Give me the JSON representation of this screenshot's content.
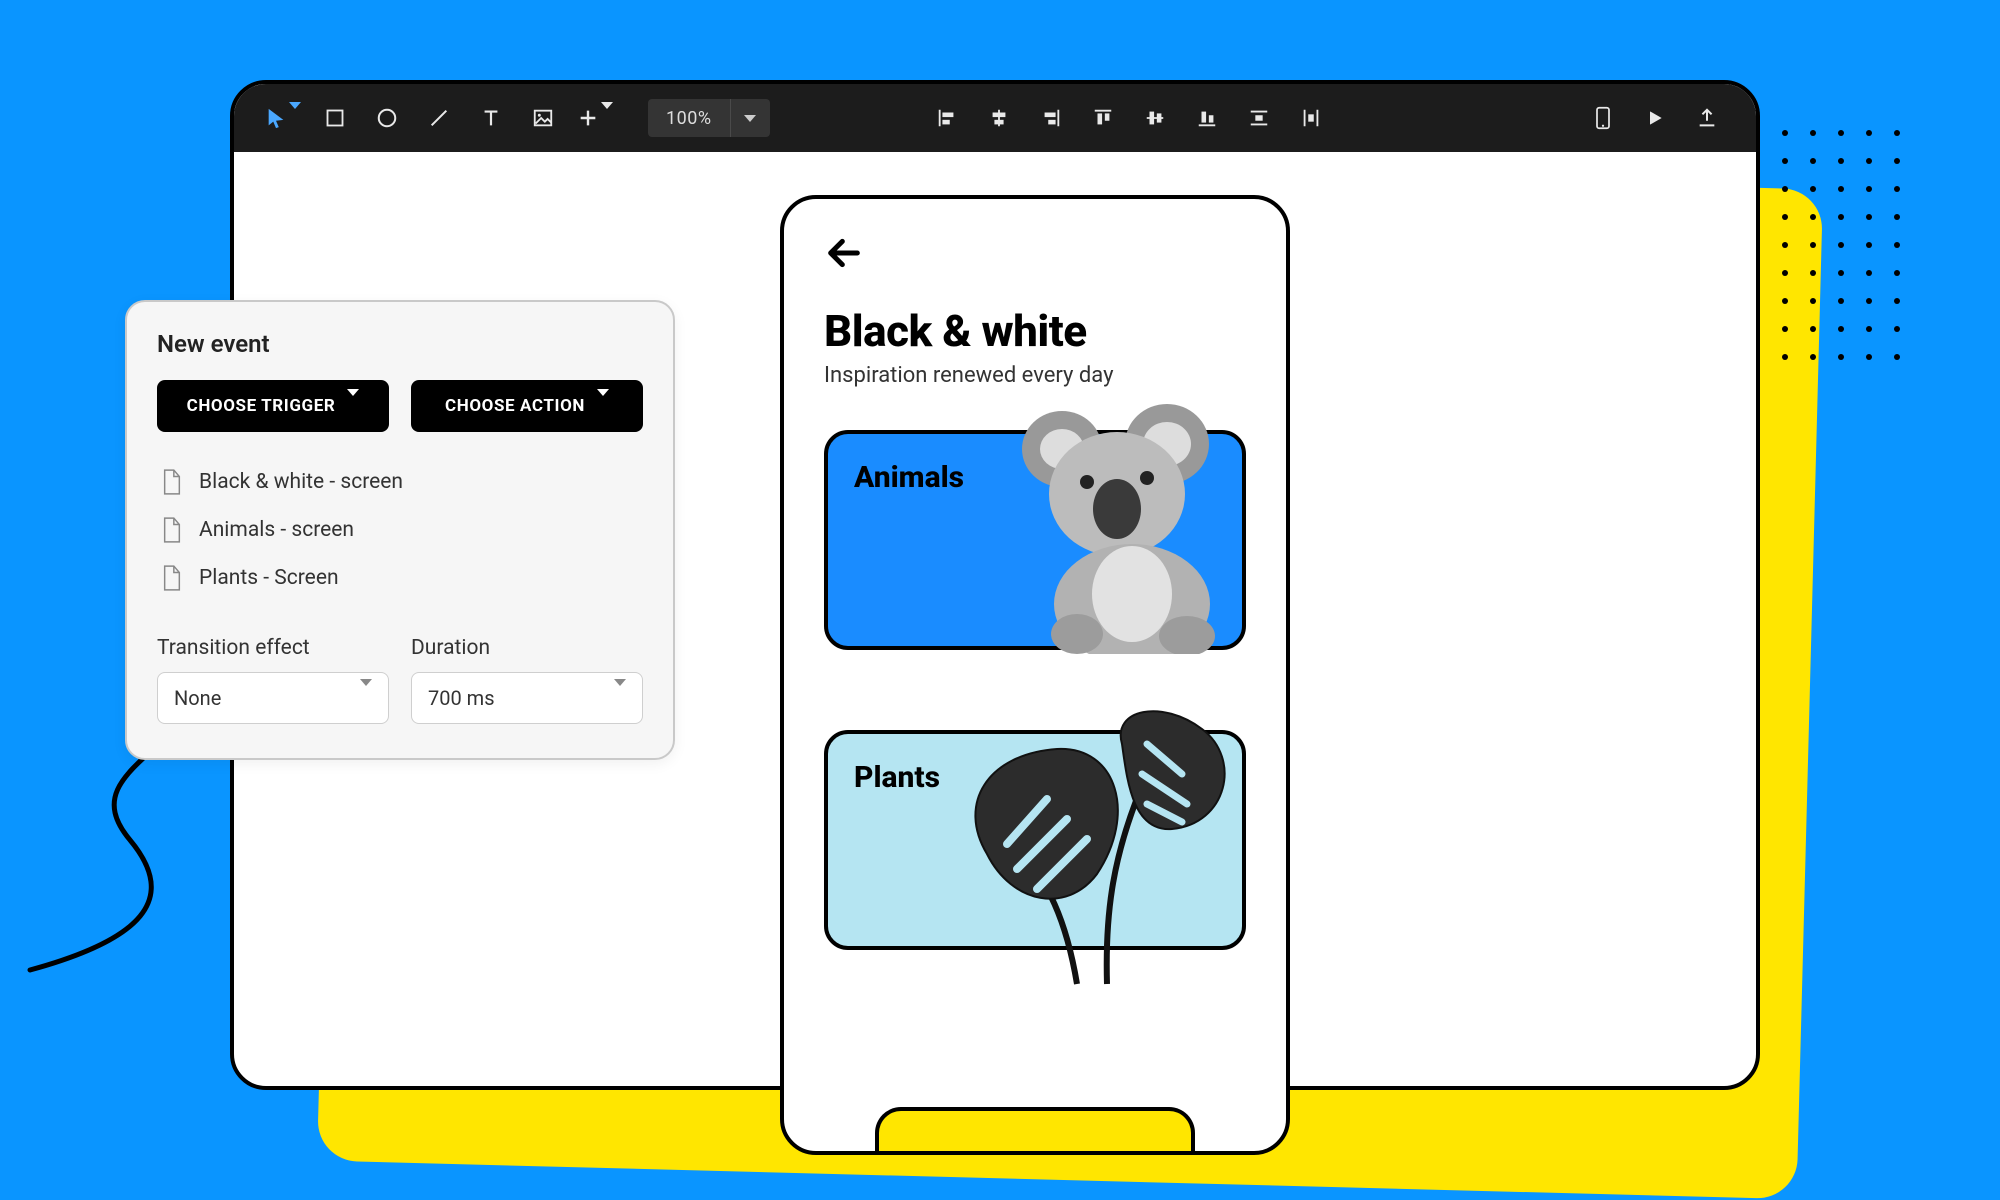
{
  "toolbar": {
    "zoom": "100%",
    "tools": {
      "select": "select",
      "rectangle": "rectangle",
      "ellipse": "ellipse",
      "line": "line",
      "text": "text",
      "image": "image",
      "add": "add"
    },
    "align": {
      "align_left": "align-left",
      "align_center_h": "align-center-horizontal",
      "align_right": "align-right",
      "align_top": "align-top",
      "align_middle_v": "align-middle-vertical",
      "align_bottom": "align-bottom",
      "distribute_v": "distribute-vertical",
      "distribute_h": "distribute-horizontal"
    },
    "right": {
      "device": "device-preview",
      "play": "play",
      "export": "export"
    }
  },
  "panel": {
    "title": "New event",
    "trigger_btn": "CHOOSE TRIGGER",
    "action_btn": "CHOOSE ACTION",
    "screens": [
      "Black & white - screen",
      "Animals - screen",
      "Plants - Screen"
    ],
    "transition_label": "Transition effect",
    "transition_value": "None",
    "duration_label": "Duration",
    "duration_value": "700 ms"
  },
  "mobile": {
    "title": "Black & white",
    "subtitle": "Inspiration renewed every day",
    "card_animals": "Animals",
    "card_plants": "Plants"
  },
  "colors": {
    "bg": "#0a95ff",
    "accent_yellow": "#ffe600",
    "animals_card": "#1a8cff",
    "plants_card": "#b5e5f2"
  }
}
